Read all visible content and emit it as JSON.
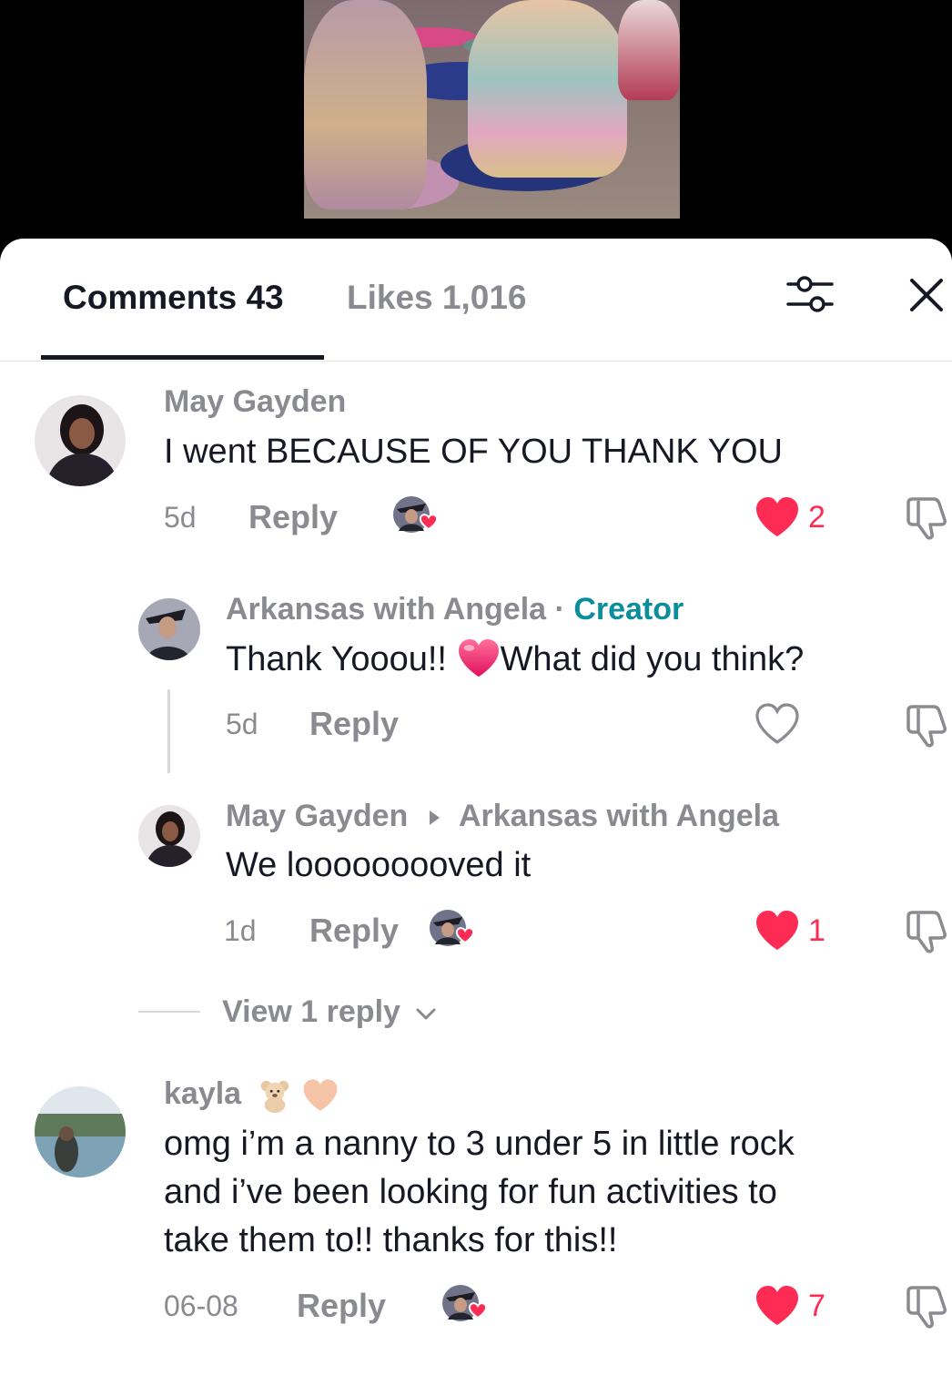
{
  "tabs": {
    "comments_label": "Comments",
    "comments_count": "43",
    "likes_label": "Likes",
    "likes_count": "1,016"
  },
  "icons": {
    "filter": "sliders-icon",
    "close": "close-icon",
    "like": "heart-icon",
    "dislike": "thumbs-down-icon",
    "creator_liked": "creator-liked-avatar-icon",
    "expand": "chevron-down-icon"
  },
  "colors": {
    "like_active": "#fe2c55",
    "creator_tag": "#0a8d9c",
    "secondary_text": "#8a8b91",
    "primary_text": "#161823"
  },
  "comments": [
    {
      "username": "May Gayden",
      "text": "I went BECAUSE OF YOU THANK YOU",
      "time": "5d",
      "reply_label": "Reply",
      "likes": "2",
      "liked": true,
      "liked_by_creator": true
    },
    {
      "username": "Arkansas with Angela",
      "separator": "·",
      "badge": "Creator",
      "text_before_emoji": "Thank Yooou!!",
      "emoji": "heart-emoji",
      "text_after_emoji": "What did you think?",
      "time": "5d",
      "reply_label": "Reply",
      "liked": false
    },
    {
      "username": "May Gayden",
      "reply_to": "Arkansas with Angela",
      "text": "We looooooooved it",
      "time": "1d",
      "reply_label": "Reply",
      "likes": "1",
      "liked": true,
      "liked_by_creator": true
    },
    {
      "username": "kayla",
      "username_emojis": [
        "teddy-bear-emoji",
        "peach-heart-emoji"
      ],
      "text_lines": [
        "omg i’m a nanny to 3 under 5 in little rock",
        "and i’ve been looking for fun activities to",
        "take them to!! thanks for this!!"
      ],
      "time": "06-08",
      "reply_label": "Reply",
      "likes": "7",
      "liked": true,
      "liked_by_creator": true
    }
  ],
  "view_replies_label": "View 1 reply"
}
